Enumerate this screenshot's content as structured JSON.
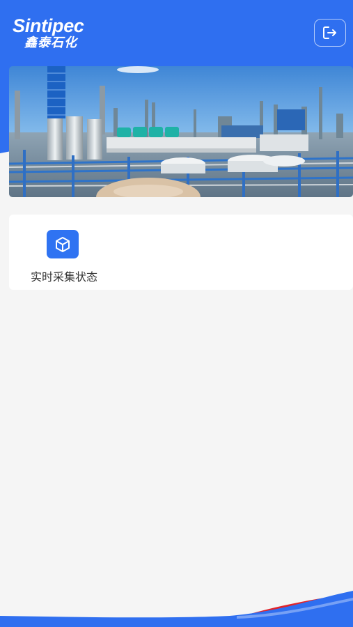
{
  "header": {
    "logo_en": "Sintipec",
    "logo_cn": "鑫泰石化",
    "logout_icon": "logout-icon",
    "bg_color": "#2f6ff0"
  },
  "banner": {
    "image": "refinery-plant-photo"
  },
  "functions": [
    {
      "label": "实时采集状态",
      "icon": "cube-icon",
      "color": "#2f73f2"
    }
  ],
  "footer": {
    "wave_colors": [
      "#2f6ff0",
      "#e0242b"
    ]
  }
}
